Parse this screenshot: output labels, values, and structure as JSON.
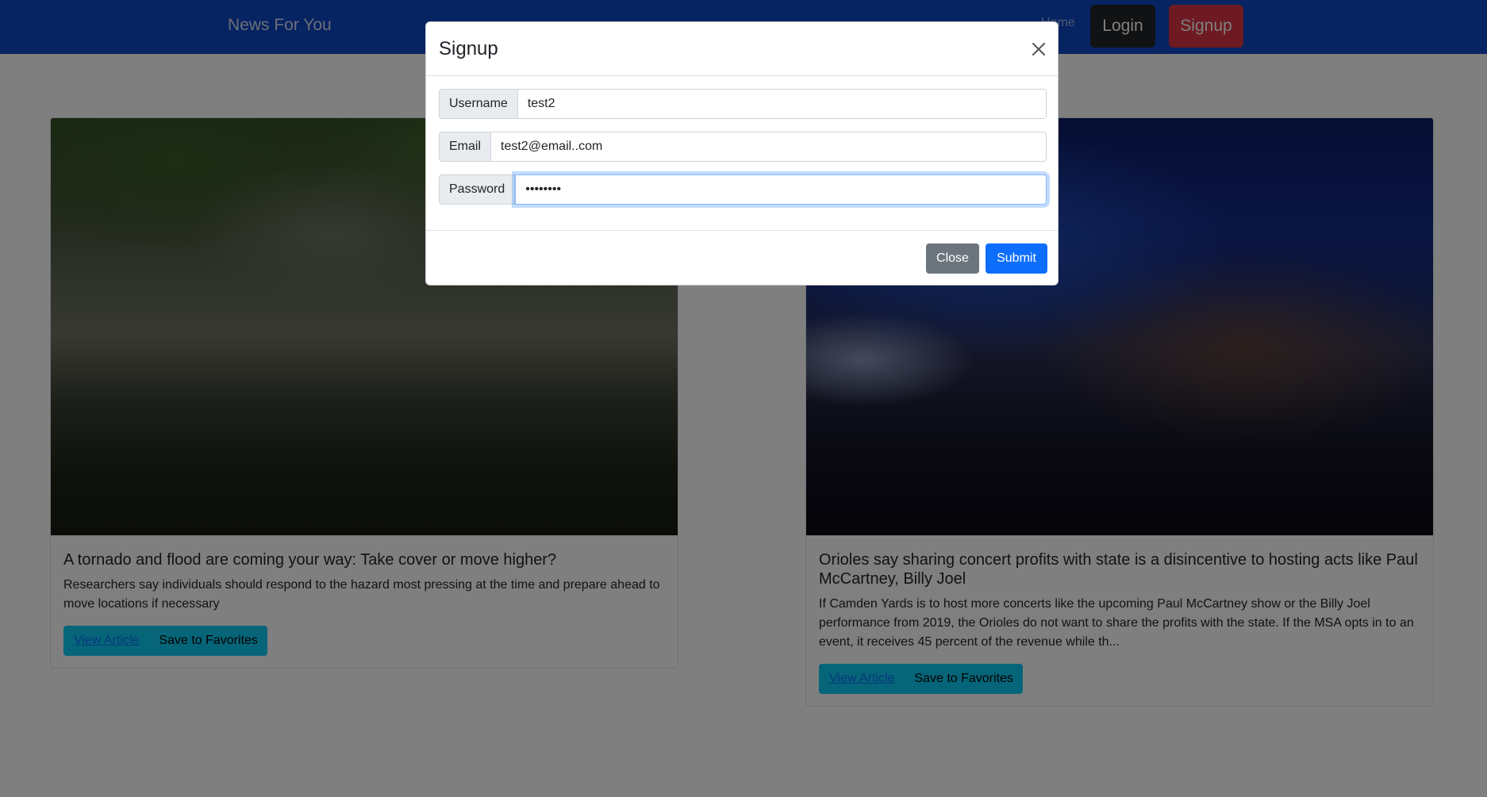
{
  "navbar": {
    "brand": "News For You",
    "home_label": "Home",
    "login_label": "Login",
    "signup_label": "Signup"
  },
  "articles": [
    {
      "title": "A tornado and flood are coming your way: Take cover or move higher?",
      "description": "Researchers say individuals should respond to the hazard most pressing at the time and prepare ahead to move locations if necessary",
      "view_label": "View Article",
      "favorite_label": "Save to Favorites"
    },
    {
      "title": "Orioles say sharing concert profits with state is a disincentive to hosting acts like Paul McCartney, Billy Joel",
      "description": "If Camden Yards is to host more concerts like the upcoming Paul McCartney show or the Billy Joel performance from 2019, the Orioles do not want to share the profits with the state. If the MSA opts in to an event, it receives 45 percent of the revenue while th...",
      "view_label": "View Article",
      "favorite_label": "Save to Favorites"
    }
  ],
  "modal": {
    "title": "Signup",
    "fields": {
      "username": {
        "label": "Username",
        "value": "test2"
      },
      "email": {
        "label": "Email",
        "value": "test2@email..com"
      },
      "password": {
        "label": "Password",
        "value": "••••••••"
      }
    },
    "close_label": "Close",
    "submit_label": "Submit"
  },
  "colors": {
    "navbar": "#0d46c4",
    "login": "#212529",
    "signup": "#dc3545",
    "info": "#0dcaf0",
    "primary": "#0d6efd",
    "secondary": "#6c757d"
  },
  "icons": {
    "modal_close": "close-icon"
  }
}
